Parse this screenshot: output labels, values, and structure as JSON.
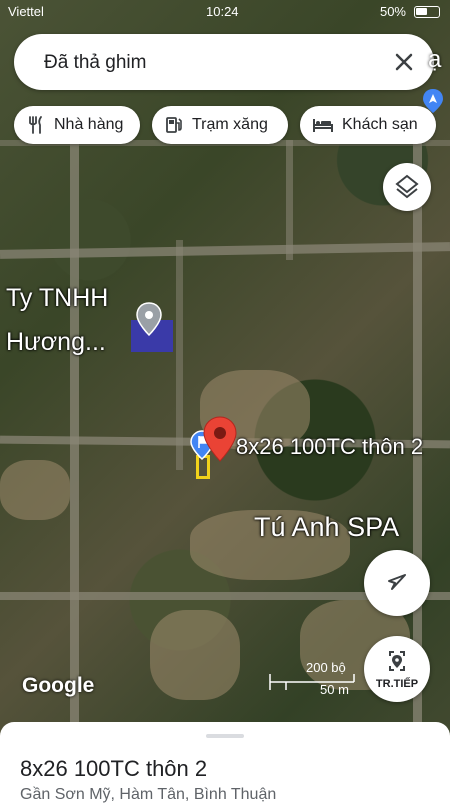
{
  "status_bar": {
    "carrier": "Viettel",
    "time": "10:24",
    "battery": "50%",
    "battery_level": 0.5
  },
  "search": {
    "text": "Đã thả ghim",
    "partial_place": "ạ"
  },
  "chips": [
    {
      "label": "Nhà hàng",
      "icon": "fork-knife-icon"
    },
    {
      "label": "Trạm xăng",
      "icon": "gas-station-icon"
    },
    {
      "label": "Khách sạn",
      "icon": "bed-icon"
    }
  ],
  "map": {
    "labels": {
      "company_line1": "Ty TNHH",
      "company_line2": "Hương...",
      "pin_label": "8x26 100TC thôn 2",
      "spa": "Tú Anh SPA"
    },
    "google_logo": "Google",
    "scale": {
      "top": "200 bộ",
      "bottom": "50 m"
    }
  },
  "buttons": {
    "layers": "layers-icon",
    "my_location": "navigation-arrow-icon",
    "next_label": "TR.TIẾP"
  },
  "place_sheet": {
    "title": "8x26 100TC thôn 2",
    "subtitle": "Gần Sơn Mỹ, Hàm Tân, Bình Thuận"
  },
  "colors": {
    "pin_red": "#ea4335",
    "marker_blue": "#4285f4",
    "outline_yellow": "#f2d21b"
  }
}
